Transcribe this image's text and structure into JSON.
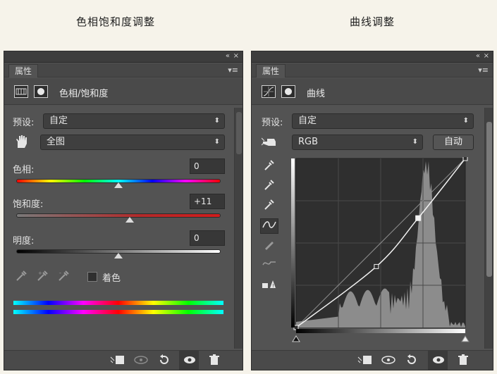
{
  "captions": {
    "left": "色相饱和度调整",
    "right": "曲线调整"
  },
  "panel_common": {
    "tab": "属性",
    "collapse_glyph": "«",
    "close_glyph": "×",
    "menu_glyph": "▾≡",
    "preset_label": "预设:",
    "preset_value": "自定"
  },
  "hue_sat": {
    "title": "色相/饱和度",
    "range_value": "全图",
    "hue_label": "色相:",
    "hue_value": "0",
    "hue_level": 0.5,
    "sat_label": "饱和度:",
    "sat_value": "+11",
    "sat_level": 0.555,
    "light_label": "明度:",
    "light_value": "0",
    "light_level": 0.5,
    "colorize_label": "着色"
  },
  "curves": {
    "title": "曲线",
    "channel": "RGB",
    "auto_label": "自动",
    "curve_points": [
      [
        0,
        0
      ],
      [
        121,
        92
      ],
      [
        184,
        165
      ],
      [
        255,
        255
      ]
    ]
  },
  "icons": {
    "eyedropper": "eyedropper-icon",
    "hand": "hand-icon",
    "pencil": "pencil-icon",
    "eye": "eye-icon",
    "trash": "trash-icon",
    "reset": "reset-icon",
    "clip": "clip-to-layer-icon"
  }
}
